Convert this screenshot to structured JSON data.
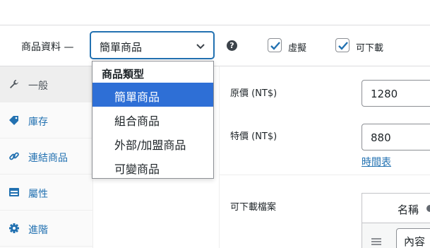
{
  "product_data": {
    "label": "商品資料 —",
    "type_select": {
      "value": "簡單商品"
    },
    "help_icon": "?",
    "virtual": {
      "label": "虛擬",
      "checked": true
    },
    "downloadable": {
      "label": "可下載",
      "checked": true
    }
  },
  "dropdown": {
    "group_label": "商品類型",
    "options": [
      {
        "label": "簡單商品",
        "selected": true
      },
      {
        "label": "組合商品",
        "selected": false
      },
      {
        "label": "外部/加盟商品",
        "selected": false
      },
      {
        "label": "可變商品",
        "selected": false
      }
    ]
  },
  "tabs": [
    {
      "label": "一般",
      "icon": "wrench-icon",
      "active": true
    },
    {
      "label": "庫存",
      "icon": "tag-icon",
      "active": false
    },
    {
      "label": "連結商品",
      "icon": "link-icon",
      "active": false
    },
    {
      "label": "屬性",
      "icon": "table-icon",
      "active": false
    },
    {
      "label": "進階",
      "icon": "gear-icon",
      "active": false
    }
  ],
  "general": {
    "regular_price": {
      "label": "原價 (NT$)",
      "value": "1280"
    },
    "sale_price": {
      "label": "特價 (NT$)",
      "value": "880"
    },
    "schedule_link": "時間表"
  },
  "downloads": {
    "label": "可下載檔案",
    "column_name": "名稱",
    "row_value": "內容"
  },
  "colors": {
    "accent": "#2271b1",
    "selected_option": "#2e6fd6"
  }
}
